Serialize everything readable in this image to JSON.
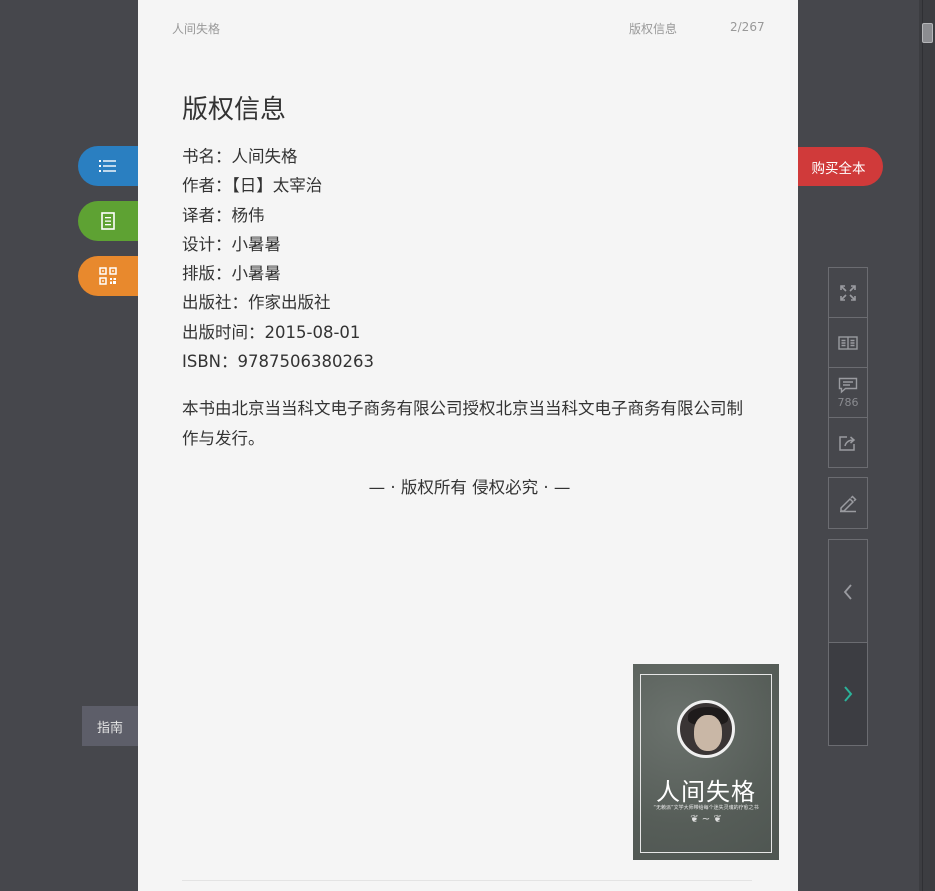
{
  "header": {
    "book_title": "人间失格",
    "chapter": "版权信息",
    "page_indicator": "2/267"
  },
  "content": {
    "title": "版权信息",
    "meta": [
      "书名：人间失格",
      "作者：【日】太宰治",
      "译者：杨伟",
      "设计：小暑暑",
      "排版：小暑暑",
      "出版社：作家出版社",
      "出版时间：2015-08-01",
      "ISBN：9787506380263"
    ],
    "statement": "本书由北京当当科文电子商务有限公司授权北京当当科文电子商务有限公司制作与发行。",
    "rights": "— · 版权所有 侵权必究 · —"
  },
  "cover": {
    "title": "人间失格",
    "subtitle": "“无赖派”文学大师带给每个迷失灵魂的疗愈之书",
    "ornament": "❦ ~ ❦"
  },
  "left_buttons": {
    "toc_icon": "list-icon",
    "note_icon": "note-icon",
    "qr_icon": "qrcode-icon",
    "guide_label": "指南"
  },
  "buy_button": {
    "label": "购买全本"
  },
  "toolbar": {
    "fullscreen_icon": "fullscreen-icon",
    "directory_icon": "book-directory-icon",
    "comment_icon": "comment-icon",
    "comment_count": "786",
    "share_icon": "share-icon",
    "pen_icon": "pen-icon",
    "prev_icon": "chevron-left-icon",
    "next_icon": "chevron-right-icon"
  },
  "colors": {
    "background": "#46474c",
    "page": "#f5f5f5",
    "toc_button": "#2a7fc1",
    "note_button": "#5ea233",
    "qr_button": "#e8892d",
    "buy_button": "#d03a3a",
    "next_arrow": "#2bb39a"
  }
}
